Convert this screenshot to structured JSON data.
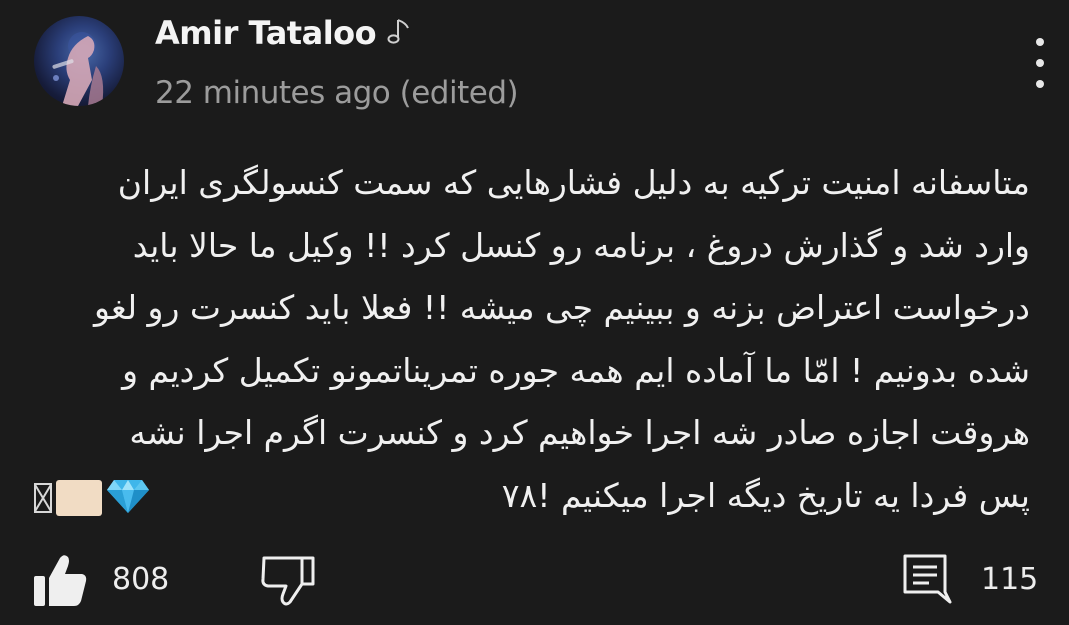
{
  "comment": {
    "author": "Amir Tataloo",
    "author_badge_icon": "music-note-icon",
    "timestamp": "22 minutes ago (edited)",
    "body_lines": [
      "متاسفانه امنیت ترکیه به دلیل فشارهایی که سمت کنسولگری ایران",
      "وارد شد و گذارش دروغ ، برنامه رو کنسل کرد !! وکیل ما حالا باید",
      "درخواست اعتراض بزنه و ببینیم چی میشه !! فعلا باید کنسرت رو لغو",
      "شده بدونیم ! امّا ما آماده ایم همه جوره تمریناتمونو تکمیل کردیم و",
      "هروقت اجازه صادر شه اجرا خواهیم کرد و کنسرت اگرم اجرا نشه",
      "پس فردا یه تاریخ دیگه اجرا میکنیم !۷۸"
    ],
    "trailing_emojis": [
      "gem-stone-emoji",
      "skin-tone-square",
      "missing-glyph-box"
    ],
    "more_icon": "more-vertical-icon"
  },
  "actions": {
    "like_icon": "thumbs-up-icon",
    "like_count": "808",
    "dislike_icon": "thumbs-down-icon",
    "reply_icon": "comment-icon",
    "reply_count": "115"
  },
  "colors": {
    "background": "#1b1b1b",
    "text_primary": "#f0f0f0",
    "text_secondary": "#9c9c9c"
  }
}
